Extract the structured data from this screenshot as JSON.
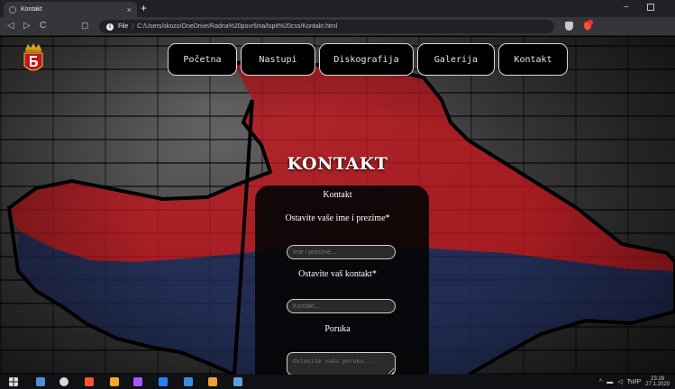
{
  "browser": {
    "tab_title": "Kontakt",
    "tab_close": "×",
    "new_tab": "+",
    "minimize": "–",
    "back": "◁",
    "forward": "▷",
    "reload": "C",
    "bookmark": "◻",
    "info": "i",
    "url_scheme": "File",
    "url_sep": "|",
    "url": "C:/Users/skozo/OneDrive/Radna%20površina/Ispit%20css/Kontakt.html"
  },
  "nav": {
    "items": [
      "Početna",
      "Nastupi",
      "Diskografija",
      "Galerija",
      "Kontakt"
    ]
  },
  "page": {
    "heading": "KONTAKT",
    "form": {
      "title": "Kontakt",
      "name_label": "Ostavite vaše ime i prezime*",
      "name_placeholder": "Ime i prezime...",
      "contact_label": "Ostavite vaš kontakt*",
      "contact_placeholder": "Kontakt...",
      "message_label": "Poruka",
      "message_placeholder": "Ostavite vašu poruku..."
    }
  },
  "taskbar": {
    "tray_lang": "ЋИР",
    "tray_chevron": "^",
    "time": "23:28",
    "date": "27.1.2020"
  },
  "colors": {
    "map_red": "#c4161c",
    "map_blue": "#1e2a5a",
    "form_bg": "#050505"
  }
}
